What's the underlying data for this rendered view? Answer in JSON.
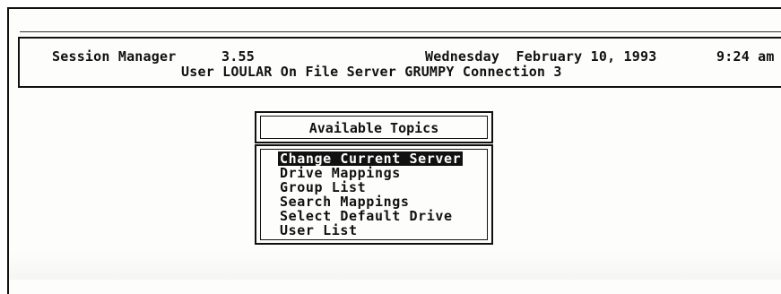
{
  "header": {
    "app_title": "Session Manager",
    "version": "3.55",
    "date": "Wednesday  February 10, 1993",
    "time": "9:24 am",
    "session_info": "User LOULAR On File Server GRUMPY Connection 3"
  },
  "topics": {
    "title": "Available Topics",
    "selected_index": 0,
    "items": [
      {
        "label": "Change Current Server"
      },
      {
        "label": "Drive Mappings"
      },
      {
        "label": "Group List"
      },
      {
        "label": "Search Mappings"
      },
      {
        "label": "Select Default Drive"
      },
      {
        "label": "User List"
      }
    ]
  },
  "colors": {
    "foreground": "#111111",
    "background": "#fdfdfb",
    "highlight_bg": "#111111",
    "highlight_fg": "#fdfdfb"
  }
}
